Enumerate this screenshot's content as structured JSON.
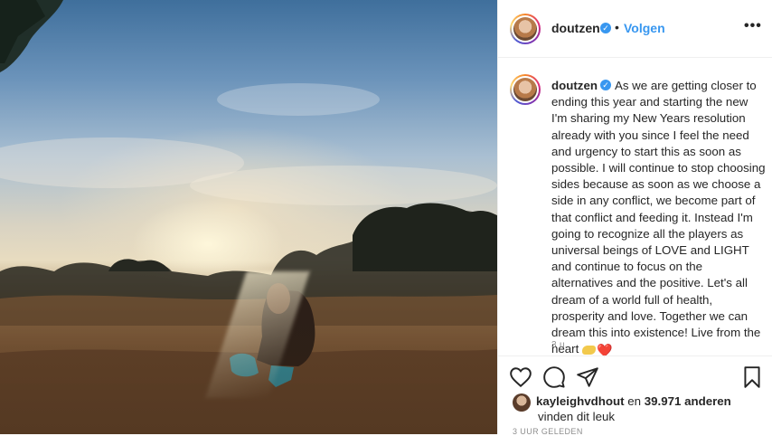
{
  "header": {
    "username": "doutzen",
    "separator": "•",
    "follow_label": "Volgen",
    "more_label": "•••"
  },
  "caption": {
    "username": "doutzen",
    "text": "As we are getting closer to ending this year and starting the new I'm sharing my New Years resolution already with you since I feel the need and urgency to start this as soon as possible. I will continue to stop choosing sides because as soon as we choose a side in any conflict, we become part of that conflict and feeding it. Instead I'm going to recognize all the players as universal beings of LOVE and LIGHT and continue to focus on the alternatives and the positive. Let's all dream of a world full of health, prosperity and love. Together we can dream this into existence! Live from the heart",
    "emoji_heart": "❤️",
    "timestamp": "3 u."
  },
  "likes": {
    "liker": "kayleighvdhout",
    "conjunction": " en ",
    "count": "39.971 anderen",
    "suffix": "vinden dit leuk"
  },
  "posted_label": "3 UUR GELEDEN",
  "icons": {
    "verified": "verified-badge-icon",
    "like": "heart-icon",
    "comment": "comment-icon",
    "share": "share-icon",
    "save": "bookmark-icon"
  },
  "colors": {
    "accent": "#3897f0",
    "text": "#262626",
    "muted": "#8e8e8e",
    "border": "#efefef"
  }
}
